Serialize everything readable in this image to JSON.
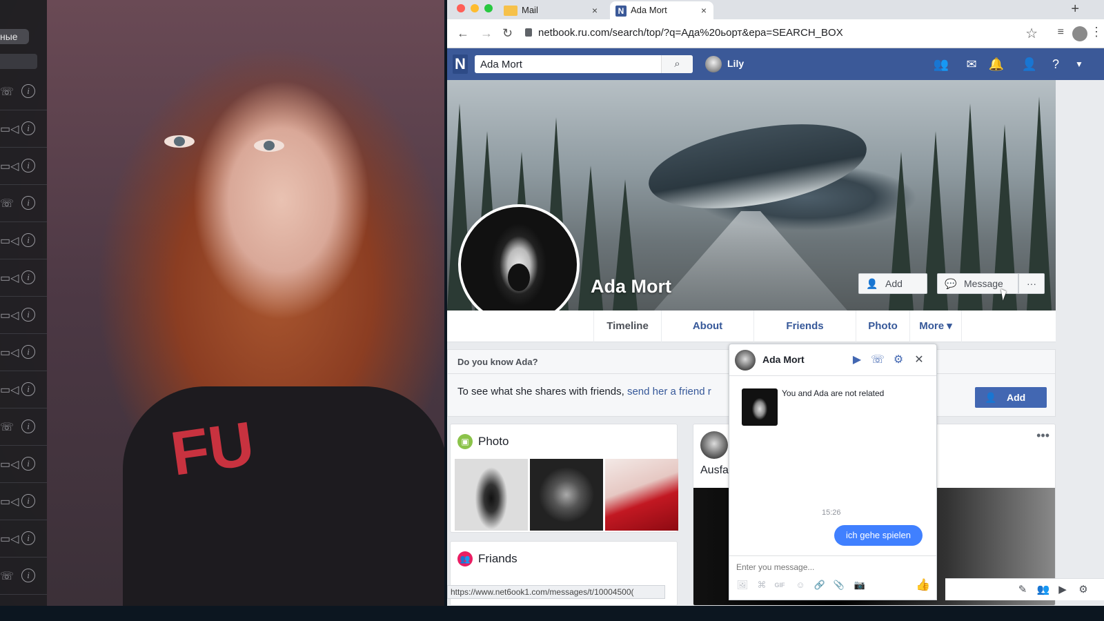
{
  "left_panel": {
    "chip_text": "ные",
    "log_rows": [
      {
        "icon": "phone-icon",
        "glyph": "☏"
      },
      {
        "icon": "video-icon",
        "glyph": "▭◁"
      },
      {
        "icon": "video-icon",
        "glyph": "▭◁"
      },
      {
        "icon": "phone-icon",
        "glyph": "☏"
      },
      {
        "icon": "video-icon",
        "glyph": "▭◁"
      },
      {
        "icon": "video-icon",
        "glyph": "▭◁"
      },
      {
        "icon": "video-icon",
        "glyph": "▭◁"
      },
      {
        "icon": "video-icon",
        "glyph": "▭◁"
      },
      {
        "icon": "video-icon",
        "glyph": "▭◁"
      },
      {
        "icon": "phone-icon",
        "glyph": "☏"
      },
      {
        "icon": "video-icon",
        "glyph": "▭◁"
      },
      {
        "icon": "video-icon",
        "glyph": "▭◁"
      },
      {
        "icon": "video-icon",
        "glyph": "▭◁"
      },
      {
        "icon": "phone-icon",
        "glyph": "☏"
      }
    ],
    "info_glyph": "i",
    "shirt_print": "FU"
  },
  "browser": {
    "tabs": [
      {
        "label": "Mail",
        "close": "×",
        "active": false
      },
      {
        "label": "Ada Mort",
        "close": "×",
        "active": true,
        "favicon": "N"
      }
    ],
    "new_tab": "+",
    "url": "netbook.ru.com/search/top/?q=Ада%20ьорт&epa=SEARCH_BOX",
    "status_url": "https://www.net6ook1.com/messages/t/10004500("
  },
  "netbook": {
    "logo": "N",
    "search_value": "Ada Mort",
    "user_name": "Lily",
    "profile": {
      "name": "Ada Mort",
      "add_label": "Add",
      "message_label": "Message",
      "more_dots": "···",
      "tabs": [
        "Timeline",
        "About",
        "Friends",
        "Photo",
        "More ▾"
      ]
    },
    "know": {
      "question": "Do you know Ada?",
      "message_prefix": "To see what she shares with friends, ",
      "message_link": "send her a friend r",
      "add_label": "Add"
    },
    "photo_card_title": "Photo",
    "friends_card_title": "Friands",
    "post_text": "Ausfa",
    "post_dots": "•••"
  },
  "chat": {
    "name": "Ada Mort",
    "related_text": "You and Ada are not related",
    "time": "15:26",
    "sent_message": "ich gehe spielen",
    "input_placeholder": "Enter you message...",
    "tools": [
      "🖼",
      "⌘",
      "GIF",
      "☺",
      "🔗",
      "📎",
      "📷"
    ]
  },
  "colors": {
    "netbook_blue": "#3b5998",
    "button_blue": "#4267b2",
    "bubble_blue": "#4080ff"
  }
}
